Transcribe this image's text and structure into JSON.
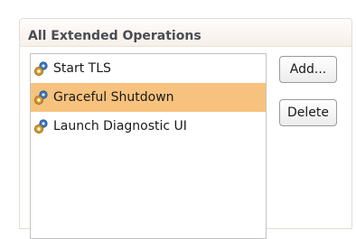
{
  "panel": {
    "title": "All Extended Operations"
  },
  "operations": [
    {
      "label": "Start TLS",
      "icon": "gear-icon",
      "selected": false
    },
    {
      "label": "Graceful Shutdown",
      "icon": "gear-icon",
      "selected": true
    },
    {
      "label": "Launch Diagnostic UI",
      "icon": "gear-icon",
      "selected": false
    }
  ],
  "buttons": {
    "add_label": "Add...",
    "delete_label": "Delete"
  },
  "colors": {
    "selection": "#f7c27d",
    "header_title": "#4a4c52",
    "gear_blue": "#3a78c4",
    "gear_gold": "#d39a2c"
  }
}
